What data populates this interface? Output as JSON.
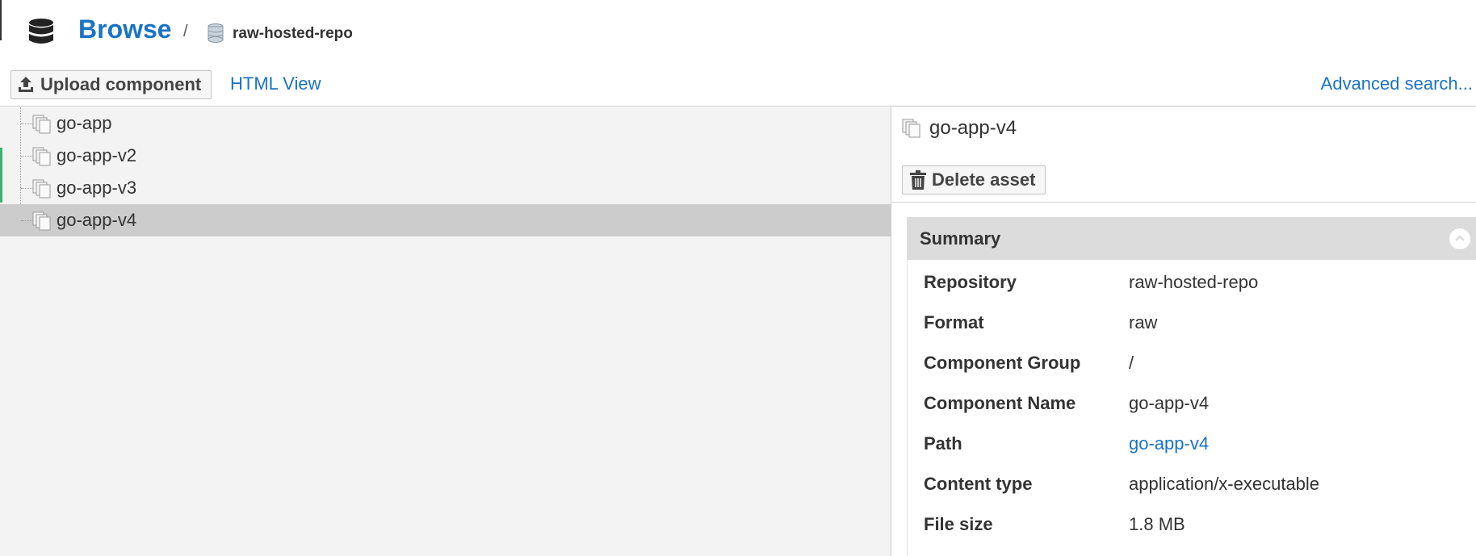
{
  "header": {
    "title": "Browse",
    "separator": "/",
    "repo_name": "raw-hosted-repo"
  },
  "toolbar": {
    "upload_label": "Upload component",
    "html_view_label": "HTML View",
    "advanced_search_label": "Advanced search..."
  },
  "tree": {
    "items": [
      {
        "label": "go-app"
      },
      {
        "label": "go-app-v2"
      },
      {
        "label": "go-app-v3"
      },
      {
        "label": "go-app-v4"
      }
    ],
    "selected_label": "go-app-v4"
  },
  "asset": {
    "title": "go-app-v4",
    "delete_label": "Delete asset"
  },
  "summary": {
    "header": "Summary",
    "rows": [
      {
        "key": "Repository",
        "value": "raw-hosted-repo"
      },
      {
        "key": "Format",
        "value": "raw"
      },
      {
        "key": "Component Group",
        "value": "/"
      },
      {
        "key": "Component Name",
        "value": "go-app-v4"
      },
      {
        "key": "Path",
        "value": "go-app-v4"
      },
      {
        "key": "Content type",
        "value": "application/x-executable"
      },
      {
        "key": "File size",
        "value": "1.8 MB"
      }
    ]
  },
  "colors": {
    "link": "#1a73c5",
    "selected_row": "#cccccc",
    "panel_bg": "#f3f3f3",
    "summary_header_bg": "#dcdcdc"
  }
}
